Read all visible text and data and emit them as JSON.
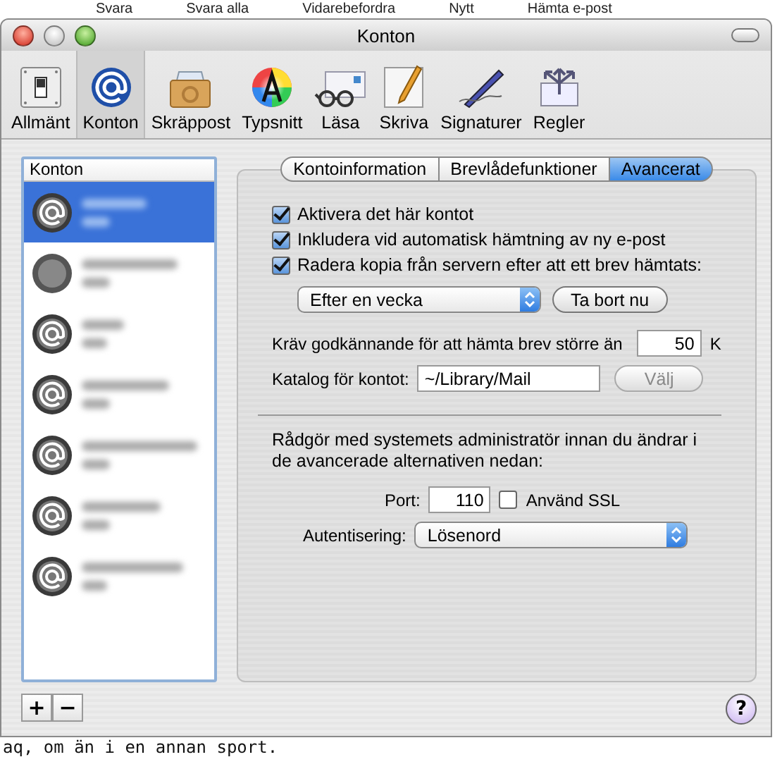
{
  "background": {
    "toolbar_labels": [
      "Svara",
      "Svara alla",
      "Vidarebefordra",
      "Nytt",
      "Hämta e-post"
    ],
    "text_line": "aq, om än i en annan sport."
  },
  "window": {
    "title": "Konton"
  },
  "toolbar": [
    {
      "label": "Allmänt",
      "kind": "switch",
      "selected": false
    },
    {
      "label": "Konton",
      "kind": "at",
      "selected": true
    },
    {
      "label": "Skräppost",
      "kind": "junk",
      "selected": false
    },
    {
      "label": "Typsnitt",
      "kind": "font",
      "selected": false
    },
    {
      "label": "Läsa",
      "kind": "read",
      "selected": false
    },
    {
      "label": "Skriva",
      "kind": "write",
      "selected": false
    },
    {
      "label": "Signaturer",
      "kind": "pen",
      "selected": false
    },
    {
      "label": "Regler",
      "kind": "rules",
      "selected": false
    }
  ],
  "accounts": {
    "header": "Konton",
    "items": [
      {
        "kind": "at",
        "selected": true
      },
      {
        "kind": "plain",
        "selected": false
      },
      {
        "kind": "at",
        "selected": false
      },
      {
        "kind": "at",
        "selected": false
      },
      {
        "kind": "at",
        "selected": false
      },
      {
        "kind": "at",
        "selected": false
      },
      {
        "kind": "at",
        "selected": false
      }
    ]
  },
  "list_buttons": [
    "+",
    "−"
  ],
  "tabs": [
    {
      "label": "Kontoinformation",
      "selected": false
    },
    {
      "label": "Brevlådefunktioner",
      "selected": false
    },
    {
      "label": "Avancerat",
      "selected": true
    }
  ],
  "options": [
    {
      "label": "Aktivera det här kontot",
      "checked": true
    },
    {
      "label": "Inkludera vid automatisk hämtning av ny e-post",
      "checked": true
    },
    {
      "label": "Radera kopia från servern efter att ett brev hämtats:",
      "checked": true
    }
  ],
  "removal": {
    "value": "Efter en vecka",
    "button": "Ta bort nu"
  },
  "size_limit": {
    "label": "Kräv godkännande för att hämta brev större än",
    "value": "50",
    "unit": "K"
  },
  "folder": {
    "label": "Katalog för kontot:",
    "value": "~/Library/Mail",
    "button": "Välj",
    "disabled": true
  },
  "notice": "Rådgör med systemets administratör innan du ändrar i de avancerade alternativen nedan:",
  "port": {
    "label": "Port:",
    "value": "110",
    "ssl_label": "Använd SSL",
    "ssl_checked": false
  },
  "auth": {
    "label": "Autentisering:",
    "value": "Lösenord"
  },
  "help": "?"
}
